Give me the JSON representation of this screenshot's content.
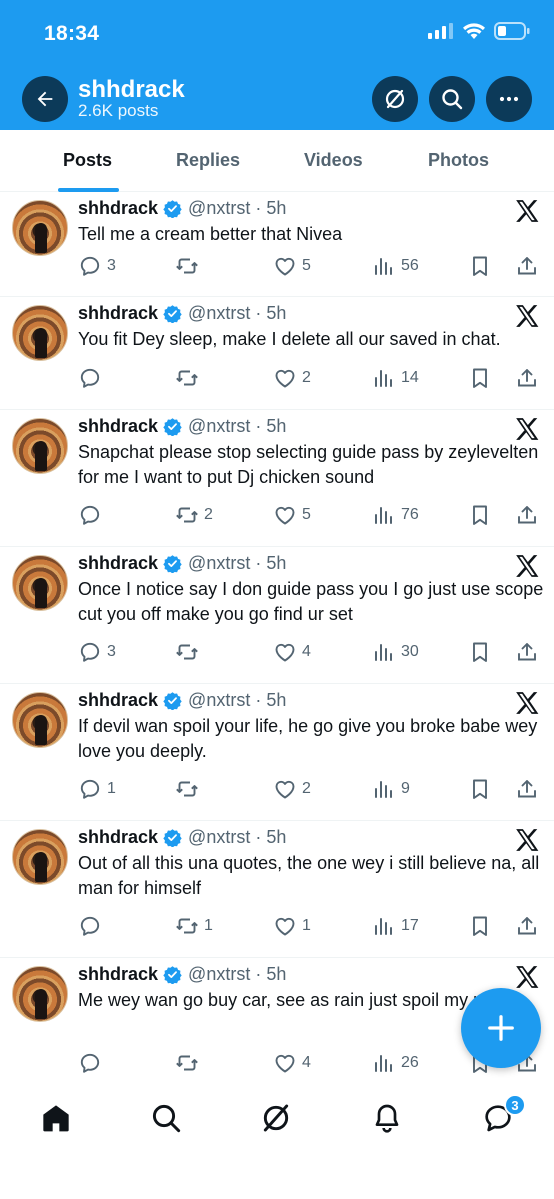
{
  "status_bar": {
    "time": "18:34"
  },
  "header": {
    "profile_name": "shhdrack",
    "post_count": "2.6K posts"
  },
  "tabs": [
    {
      "label": "Posts",
      "active": true
    },
    {
      "label": "Replies",
      "active": false
    },
    {
      "label": "Videos",
      "active": false
    },
    {
      "label": "Photos",
      "active": false
    }
  ],
  "posts": [
    {
      "author": "shhdrack",
      "handle": "@nxtrst",
      "time": "5h",
      "text": "Tell me a cream better that Nivea",
      "replies": "3",
      "reposts": "",
      "likes": "5",
      "views": "56"
    },
    {
      "author": "shhdrack",
      "handle": "@nxtrst",
      "time": "5h",
      "text": "You fit Dey sleep, make I delete all our saved in chat.",
      "replies": "",
      "reposts": "",
      "likes": "2",
      "views": "14"
    },
    {
      "author": "shhdrack",
      "handle": "@nxtrst",
      "time": "5h",
      "text": "Snapchat please stop selecting guide pass  by zeylevelten for me I want to put Dj chicken sound",
      "replies": "",
      "reposts": "2",
      "likes": "5",
      "views": "76"
    },
    {
      "author": "shhdrack",
      "handle": "@nxtrst",
      "time": "5h",
      "text": "Once I notice say I don guide pass you I go just use scope cut you off make you go find ur set",
      "replies": "3",
      "reposts": "",
      "likes": "4",
      "views": "30"
    },
    {
      "author": "shhdrack",
      "handle": "@nxtrst",
      "time": "5h",
      "text": "If devil wan spoil your life, he go give you broke babe wey love you deeply.",
      "replies": "1",
      "reposts": "",
      "likes": "2",
      "views": "9"
    },
    {
      "author": "shhdrack",
      "handle": "@nxtrst",
      "time": "5h",
      "text": "Out of all this una quotes, the one wey i still believe na, all man for himself",
      "replies": "",
      "reposts": "1",
      "likes": "1",
      "views": "17"
    },
    {
      "author": "shhdrack",
      "handle": "@nxtrst",
      "time": "5h",
      "text": "Me wey wan go buy car, see as rain just spoil my plans...",
      "replies": "",
      "reposts": "",
      "likes": "4",
      "views": "26"
    }
  ],
  "bottom_nav": {
    "messages_badge": "3"
  },
  "colors": {
    "accent": "#1d9bf0",
    "header_button": "#0c3a59",
    "text": "#0f1419",
    "muted": "#536471"
  }
}
